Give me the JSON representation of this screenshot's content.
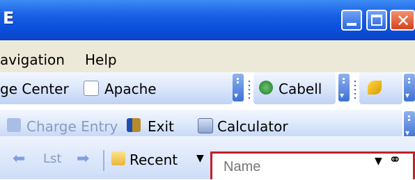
{
  "window": {
    "title": "E"
  },
  "menu": {
    "items": [
      "avigation",
      "Help"
    ]
  },
  "toolbar1": {
    "item1": "ge Center",
    "item2": "Apache",
    "item3": "Cabell"
  },
  "toolbar2": {
    "item1": "Charge Entry",
    "item2": "Exit",
    "item3": "Calculator"
  },
  "toolbar3": {
    "item1": "Lst",
    "item2": "Recent",
    "search_placeholder": "Name"
  },
  "colors": {
    "titlebar": "#0a4fdb",
    "search_border": "#c0202a"
  },
  "icons": [
    "minimize-icon",
    "maximize-icon",
    "close-icon",
    "document-icon",
    "globe-search-icon",
    "key-icon",
    "arrow-icon",
    "exit-door-icon",
    "calculator-icon",
    "back-arrow-icon",
    "forward-arrow-icon",
    "folder-icon",
    "binoculars-icon"
  ]
}
